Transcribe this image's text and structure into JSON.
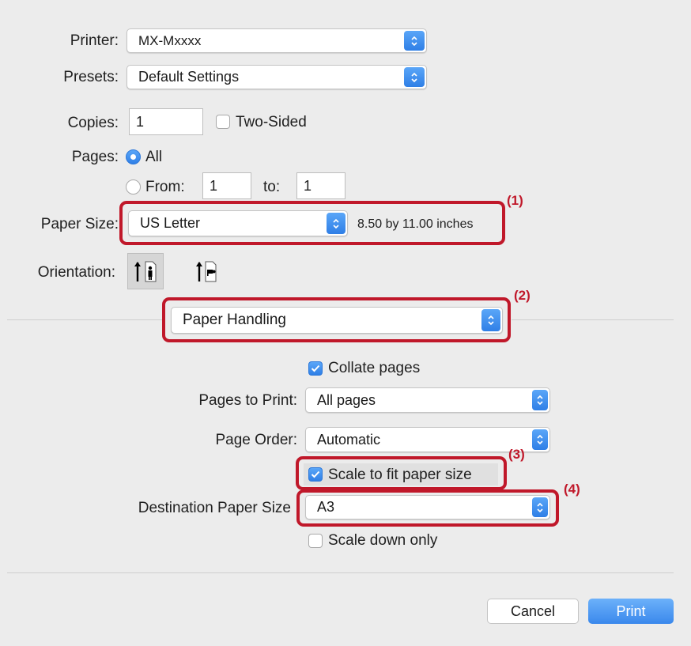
{
  "printer": {
    "label": "Printer:",
    "value": "MX-Mxxxx"
  },
  "presets": {
    "label": "Presets:",
    "value": "Default Settings"
  },
  "copies": {
    "label": "Copies:",
    "value": "1",
    "two_sided_label": "Two-Sided",
    "two_sided_checked": false
  },
  "pages": {
    "label": "Pages:",
    "all_label": "All",
    "all_selected": true,
    "from_label": "From:",
    "from_value": "1",
    "to_label": "to:",
    "to_value": "1"
  },
  "paper_size": {
    "label": "Paper Size:",
    "value": "US Letter",
    "dimensions": "8.50 by 11.00 inches"
  },
  "orientation": {
    "label": "Orientation:",
    "options": [
      "portrait",
      "landscape"
    ],
    "selected": "portrait"
  },
  "section_menu": {
    "value": "Paper Handling"
  },
  "paper_handling": {
    "collate_label": "Collate pages",
    "collate_checked": true,
    "pages_to_print_label": "Pages to Print:",
    "pages_to_print_value": "All pages",
    "page_order_label": "Page Order:",
    "page_order_value": "Automatic",
    "scale_to_fit_label": "Scale to fit paper size",
    "scale_to_fit_checked": true,
    "destination_label": "Destination Paper Size",
    "destination_value": "A3",
    "scale_down_label": "Scale down only",
    "scale_down_checked": false
  },
  "callouts": [
    "(1)",
    "(2)",
    "(3)",
    "(4)"
  ],
  "buttons": {
    "cancel": "Cancel",
    "print": "Print"
  },
  "colors": {
    "accent": "#2f7fe6",
    "highlight": "#c0182a",
    "background": "#ececec"
  }
}
